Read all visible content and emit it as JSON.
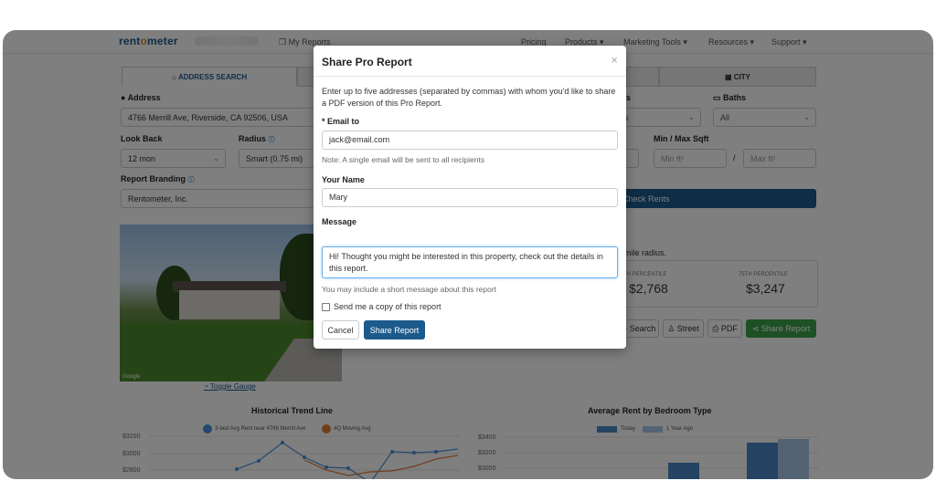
{
  "nav": {
    "logo_part1": "rent",
    "logo_o": "o",
    "logo_part2": "meter",
    "my_reports": "My Reports",
    "pricing": "Pricing",
    "products": "Products ▾",
    "marketing_tools": "Marketing Tools ▾",
    "resources": "Resources ▾",
    "support": "Support ▾"
  },
  "tabs": {
    "address_search": "ADDRESS SEARCH",
    "city": "CITY"
  },
  "form": {
    "address_label": "Address",
    "address_value": "4766 Merrill Ave, Riverside, CA 92506, USA",
    "baths_label": "Baths",
    "baths_value": "All",
    "beds_partial": "s",
    "lookback_label": "Look Back",
    "lookback_value": "12 mon",
    "radius_label": "Radius",
    "radius_value": "Smart (0.75 mi)",
    "sqft_label": "Min / Max Sqft",
    "min_sqft": "Min ft²",
    "max_sqft": "Max ft²",
    "slash": "/",
    "branding_label": "Report Branding",
    "branding_value": "Rentometer, Inc.",
    "check_rents": "Check Rents"
  },
  "results": {
    "radius_text": "mile radius.",
    "p25_label_suffix": "TH PERCENTILE",
    "p25_value": "$2,768",
    "p75_label_num": "75",
    "p75_label_suffix": "TH PERCENTILE",
    "p75_value": "$3,247"
  },
  "actions": {
    "search": "Search",
    "street": "Street",
    "pdf": "PDF",
    "share_report": "Share Report"
  },
  "photo": {
    "google": "Google",
    "toggle_gauge": "Toggle Gauge"
  },
  "trend_chart": {
    "title": "Historical Trend Line",
    "legend1": "3-bed Avg Rent near 4766 Merrill Ave",
    "legend2": "4Q Moving Avg",
    "color1": "#4a90d9",
    "color2": "#e07b39",
    "y_ticks": [
      "$3200",
      "$3000",
      "$2800"
    ]
  },
  "bed_chart": {
    "title": "Average Rent by Bedroom Type",
    "legend1": "Today",
    "legend2": "1 Year Ago",
    "color1": "#4a86c5",
    "color2": "#a9c6e8",
    "y_ticks": [
      "$3400",
      "$3200",
      "$3000",
      "$2800"
    ]
  },
  "modal": {
    "title": "Share Pro Report",
    "close": "×",
    "intro": "Enter up to five addresses (separated by commas) with whom you'd like to share a PDF version of this Pro Report.",
    "email_label": "* Email to",
    "email_value": "jack@email.com",
    "email_note": "Note: A single email will be sent to all recipients",
    "name_label": "Your Name",
    "name_value": "Mary",
    "message_label": "Message",
    "message_value": "Hi! Thought you might be interested in this property, check out the details in this report.",
    "message_note": "You may include a short message about this report",
    "copy_label": "Send me a copy of this report",
    "cancel": "Cancel",
    "share": "Share Report"
  }
}
